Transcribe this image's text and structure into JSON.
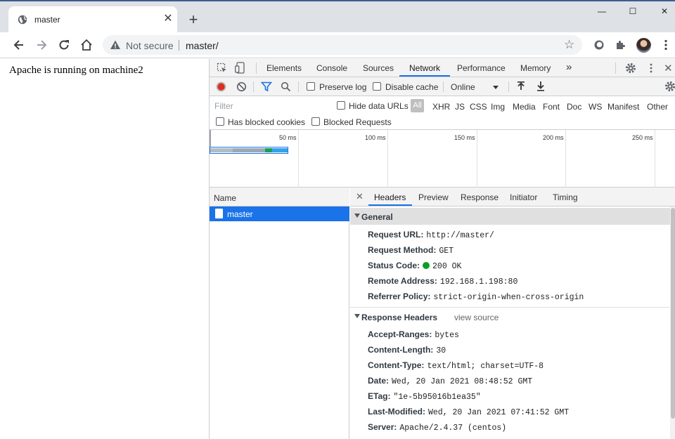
{
  "browser": {
    "tab": {
      "title": "master"
    },
    "window_controls": {
      "minimize": "—",
      "maximize": "☐",
      "close": "✕"
    },
    "omnibox": {
      "security_label": "Not secure",
      "url": "master/"
    }
  },
  "page": {
    "message": "Apache is running on machine2"
  },
  "devtools": {
    "tabs": [
      "Elements",
      "Console",
      "Sources",
      "Network",
      "Performance",
      "Memory"
    ],
    "more_tabs": "»",
    "toolbar": {
      "preserve_log": "Preserve log",
      "disable_cache": "Disable cache",
      "throttling": "Online"
    },
    "filter": {
      "placeholder": "Filter",
      "hide_data_urls": "Hide data URLs",
      "types": [
        "All",
        "XHR",
        "JS",
        "CSS",
        "Img",
        "Media",
        "Font",
        "Doc",
        "WS",
        "Manifest",
        "Other"
      ],
      "has_blocked_cookies": "Has blocked cookies",
      "blocked_requests": "Blocked Requests"
    },
    "overview": {
      "ticks": [
        "50 ms",
        "100 ms",
        "150 ms",
        "200 ms",
        "250 ms"
      ]
    },
    "request_list": {
      "column": "Name",
      "requests": [
        "master"
      ]
    },
    "detail": {
      "tabs": [
        "Headers",
        "Preview",
        "Response",
        "Initiator",
        "Timing"
      ],
      "general": {
        "title": "General",
        "rows": [
          {
            "key": "Request URL:",
            "value": "http://master/"
          },
          {
            "key": "Request Method:",
            "value": "GET"
          },
          {
            "key": "Status Code:",
            "value": "200 OK"
          },
          {
            "key": "Remote Address:",
            "value": "192.168.1.198:80"
          },
          {
            "key": "Referrer Policy:",
            "value": "strict-origin-when-cross-origin"
          }
        ]
      },
      "response_headers": {
        "title": "Response Headers",
        "view_source": "view source",
        "rows": [
          {
            "key": "Accept-Ranges:",
            "value": "bytes"
          },
          {
            "key": "Content-Length:",
            "value": "30"
          },
          {
            "key": "Content-Type:",
            "value": "text/html; charset=UTF-8"
          },
          {
            "key": "Date:",
            "value": "Wed, 20 Jan 2021 08:48:52 GMT"
          },
          {
            "key": "ETag:",
            "value": "\"1e-5b95016b1ea35\""
          },
          {
            "key": "Last-Modified:",
            "value": "Wed, 20 Jan 2021 07:41:52 GMT"
          },
          {
            "key": "Server:",
            "value": "Apache/2.4.37 (centos)"
          }
        ]
      }
    }
  },
  "colors": {
    "accent": "#1a73e8",
    "record": "#d93025",
    "status_ok": "#0a9d24"
  }
}
